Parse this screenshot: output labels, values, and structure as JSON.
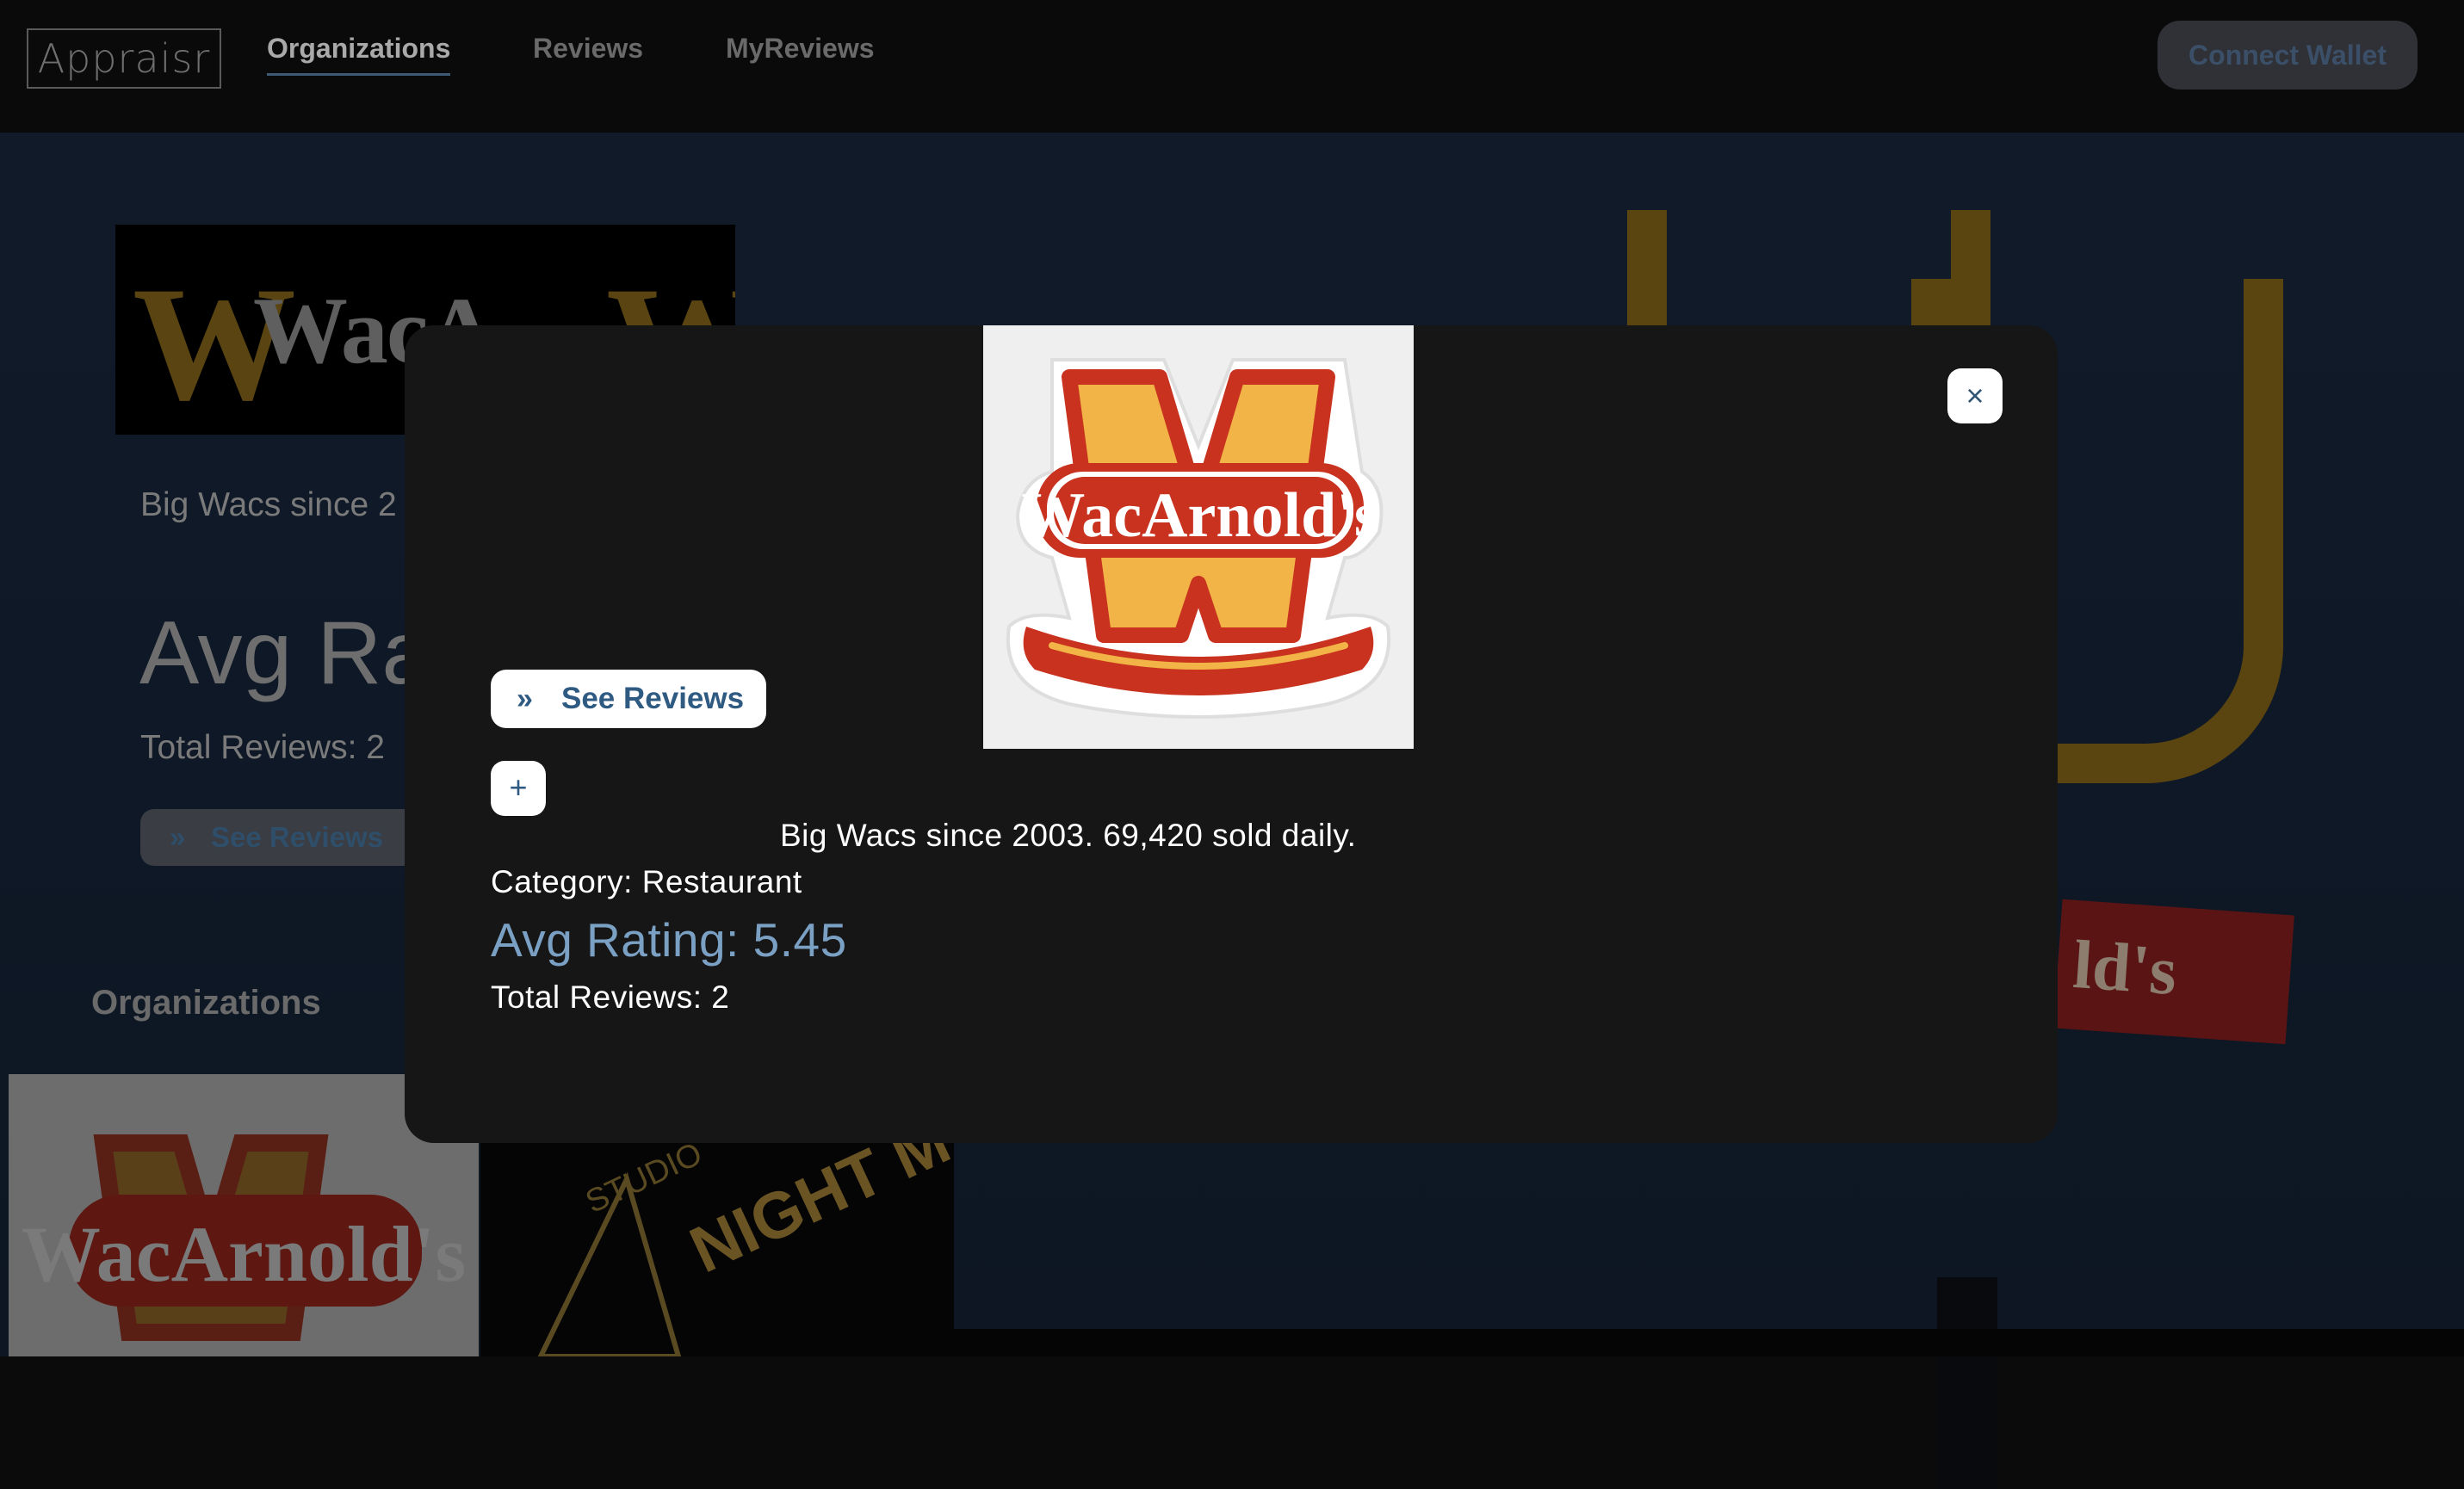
{
  "nav": {
    "logo": "Appraisr",
    "links": [
      {
        "label": "Organizations",
        "active": true
      },
      {
        "label": "Reviews",
        "active": false
      },
      {
        "label": "MyReviews",
        "active": false
      }
    ],
    "connect_wallet": "Connect Wallet"
  },
  "background": {
    "banner_text": "WacA",
    "description_partial": "Big Wacs since 2",
    "avg_rating_partial": "Avg Ra",
    "total_reviews": "Total Reviews: 2",
    "see_reviews": "See Reviews",
    "section_title": "Organizations",
    "sign_text": "ld's",
    "cards": [
      {
        "logo_text": "WacArnold's"
      },
      {
        "logo_text_top": "STUDIO",
        "logo_text_main": "NIGHT MAGIC"
      }
    ]
  },
  "modal": {
    "logo_text": "WacArnold's",
    "close_symbol": "×",
    "see_reviews": "See Reviews",
    "chevron_symbol": "»",
    "add_symbol": "+",
    "description": "Big Wacs since 2003. 69,420 sold daily.",
    "category": "Category: Restaurant",
    "avg_rating": "Avg Rating: 5.45",
    "total_reviews": "Total Reviews: 2"
  },
  "colors": {
    "modal_bg": "#161616",
    "accent_link": "#2f5a82",
    "rating_blue": "#7aa0c4",
    "logo_red": "#c8321e",
    "logo_yellow": "#f2b347"
  }
}
